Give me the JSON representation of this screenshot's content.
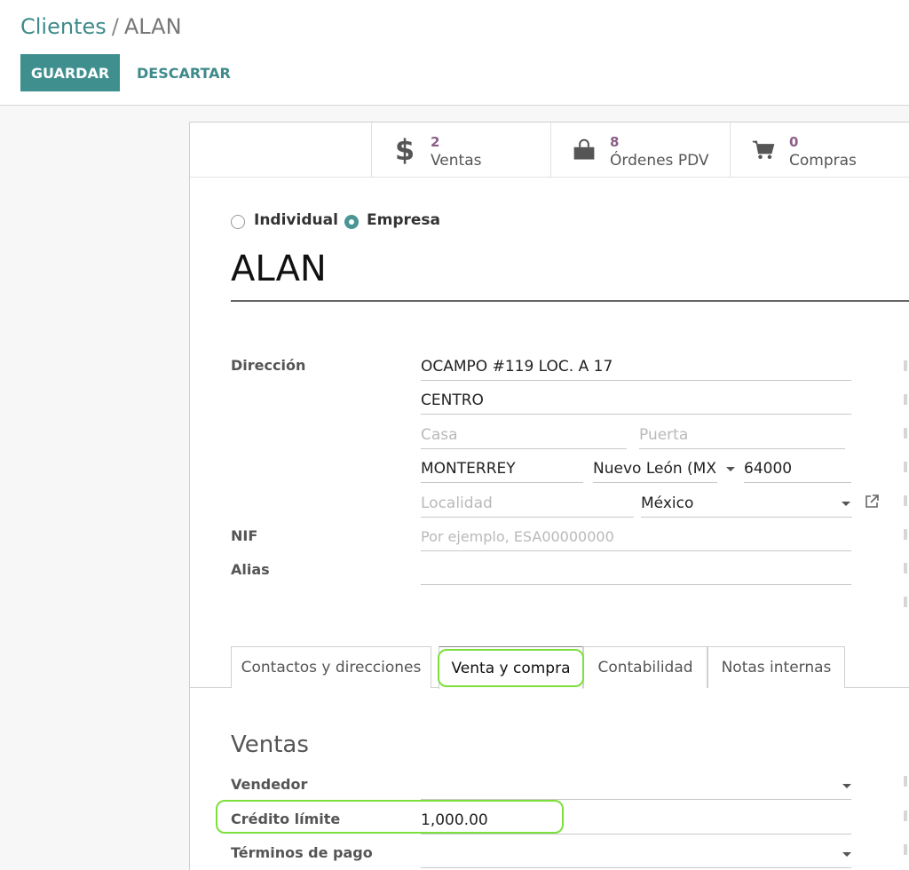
{
  "breadcrumb": {
    "parent": "Clientes",
    "separator": "/",
    "current": "ALAN"
  },
  "toolbar": {
    "save_label": "GUARDAR",
    "discard_label": "DESCARTAR"
  },
  "smart_buttons": [
    {
      "icon": "dollar-icon",
      "count": "2",
      "label": "Ventas"
    },
    {
      "icon": "shopping-bag-icon",
      "count": "8",
      "label": "Órdenes PDV"
    },
    {
      "icon": "shopping-cart-icon",
      "count": "0",
      "label": "Compras"
    }
  ],
  "company_type": {
    "options": [
      "Individual",
      "Empresa"
    ],
    "selected": "Empresa"
  },
  "partner_name": "ALAN",
  "address": {
    "label": "Dirección",
    "street": "OCAMPO #119 LOC. A 17",
    "street2": "CENTRO",
    "house_placeholder": "Casa",
    "door_placeholder": "Puerta",
    "city": "MONTERREY",
    "state": "Nuevo León (MX)",
    "zip": "64000",
    "locality_placeholder": "Localidad",
    "country": "México"
  },
  "vat": {
    "label": "NIF",
    "placeholder": "Por ejemplo, ESA00000000"
  },
  "alias": {
    "label": "Alias",
    "value": ""
  },
  "tabs": [
    {
      "label": "Contactos y direcciones",
      "active": false
    },
    {
      "label": "Venta y compra",
      "active": true
    },
    {
      "label": "Contabilidad",
      "active": false
    },
    {
      "label": "Notas internas",
      "active": false
    }
  ],
  "sales": {
    "title": "Ventas",
    "salesperson_label": "Vendedor",
    "salesperson_value": "",
    "credit_limit_label": "Crédito límite",
    "credit_limit_value": "1,000.00",
    "payment_terms_label": "Términos de pago",
    "payment_terms_value": ""
  },
  "colors": {
    "accent": "#3f8f8f",
    "count": "#8b5f86",
    "highlight": "#7ce03c"
  }
}
